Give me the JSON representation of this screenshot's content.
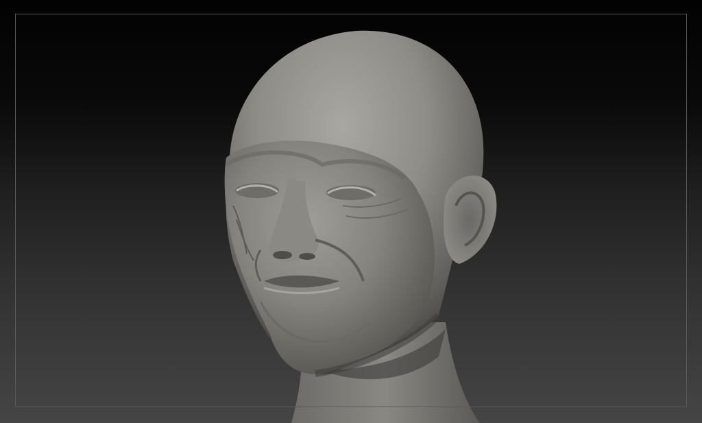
{
  "viewport": {
    "background_top": "#020202",
    "background_bottom": "#454545",
    "frame_color": "#5a5a5a"
  },
  "model": {
    "icon": "sculpted-head-mesh",
    "material_color": "#8f8d88"
  }
}
